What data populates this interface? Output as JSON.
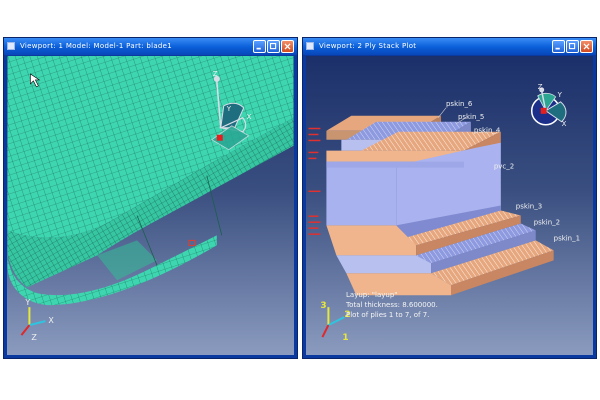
{
  "viewport1": {
    "title": "Viewport: 1    Model: Model-1    Part: blade1",
    "triad": {
      "x": "X",
      "y": "Y",
      "z": "Z"
    },
    "csys": {
      "x": "X",
      "y": "Y",
      "z": "Z"
    }
  },
  "viewport2": {
    "title": "Viewport: 2        Ply Stack Plot",
    "plies": [
      "pskin_6",
      "pskin_5",
      "pskin_4",
      "pvc_2",
      "pskin_3",
      "pskin_2",
      "pskin_1"
    ],
    "info": {
      "layup": "Layup: \"layup\"",
      "thickness": "Total thickness: 8.600000.",
      "plot": "Plot of plies 1 to 7, of 7."
    },
    "triad": {
      "one": "1",
      "two": "2",
      "three": "3"
    },
    "csys": {
      "x": "X",
      "y": "Y",
      "z": "Z"
    },
    "colors": {
      "skin": "#e7a77e",
      "stripe": "#ffffff",
      "ply_blue": "#8e9ae0",
      "core": "#a8b2ee",
      "mesh": "#3ed6b0"
    }
  }
}
